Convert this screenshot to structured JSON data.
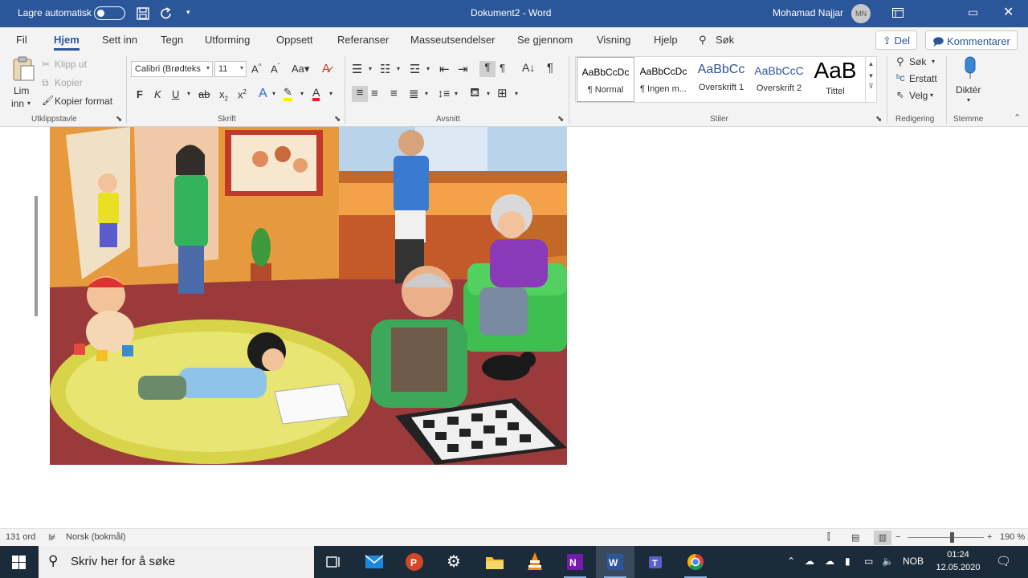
{
  "titlebar": {
    "autosave_label": "Lagre automatisk",
    "doc_title": "Dokument2 - Word",
    "user_name": "Mohamad Najjar",
    "user_initials": "MN"
  },
  "tabs": [
    {
      "label": "Fil",
      "active": false
    },
    {
      "label": "Hjem",
      "active": true
    },
    {
      "label": "Sett inn",
      "active": false
    },
    {
      "label": "Tegn",
      "active": false
    },
    {
      "label": "Utforming",
      "active": false
    },
    {
      "label": "Oppsett",
      "active": false
    },
    {
      "label": "Referanser",
      "active": false
    },
    {
      "label": "Masseutsendelser",
      "active": false
    },
    {
      "label": "Se gjennom",
      "active": false
    },
    {
      "label": "Visning",
      "active": false
    },
    {
      "label": "Hjelp",
      "active": false
    }
  ],
  "tell_me": "Søk",
  "share_label": "Del",
  "comments_label": "Kommentarer",
  "ribbon": {
    "clipboard": {
      "paste_label_1": "Lim",
      "paste_label_2": "inn",
      "cut": "Klipp ut",
      "copy": "Kopier",
      "format_painter": "Kopier format",
      "group": "Utklippstavle"
    },
    "font": {
      "font_name": "Calibri (Brødteks",
      "font_size": "11",
      "bold": "F",
      "italic": "K",
      "underline": "U",
      "group": "Skrift"
    },
    "paragraph": {
      "group": "Avsnitt"
    },
    "styles": {
      "items": [
        {
          "preview": "AaBbCcDc",
          "name": "¶ Normal"
        },
        {
          "preview": "AaBbCcDc",
          "name": "¶ Ingen m..."
        },
        {
          "preview": "AaBbCc",
          "name": "Overskrift 1"
        },
        {
          "preview": "AaBbCcC",
          "name": "Overskrift 2"
        },
        {
          "preview": "AaB",
          "name": "Tittel"
        }
      ],
      "group": "Stiler"
    },
    "editing": {
      "find": "Søk",
      "replace": "Erstatt",
      "select": "Velg",
      "group": "Redigering"
    },
    "voice": {
      "dictate": "Diktér",
      "group": "Stemme"
    }
  },
  "statusbar": {
    "word_count": "131 ord",
    "language": "Norsk (bokmål)",
    "zoom": "190 %"
  },
  "taskbar": {
    "search_placeholder": "Skriv her for å søke",
    "input_lang": "NOB",
    "time": "01:24",
    "date": "12.05.2020"
  },
  "colors": {
    "word_blue": "#2b579a",
    "ribbon_bg": "#f3f3f3",
    "taskbar_bg": "#1c2b3a"
  }
}
